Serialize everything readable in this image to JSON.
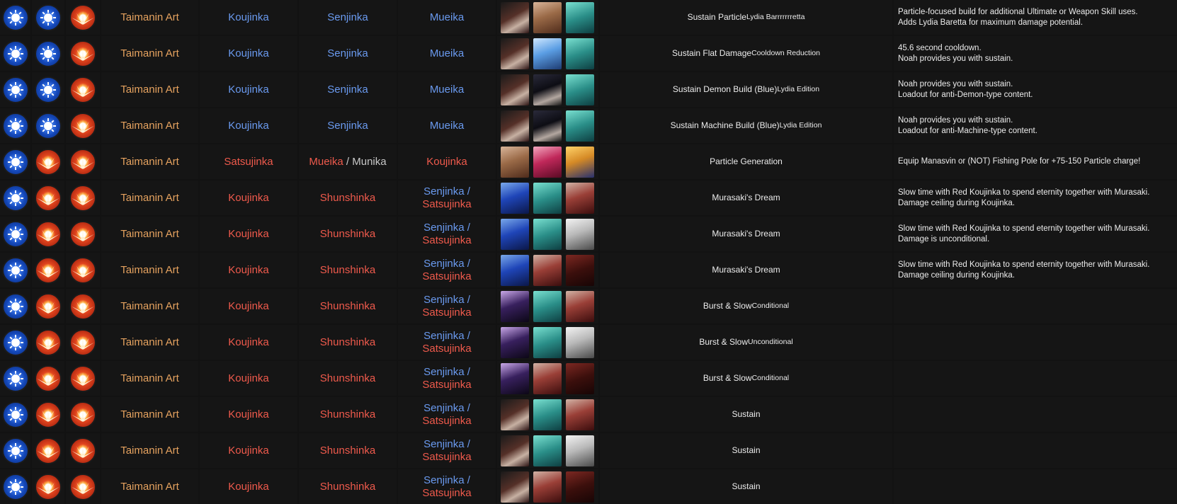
{
  "rows": [
    {
      "orbs": [
        "blue",
        "blue",
        "red"
      ],
      "specials": [
        {
          "parts": [
            {
              "text": "Taimanin Art",
              "color": "orange"
            }
          ]
        },
        {
          "parts": [
            {
              "text": "Koujinka",
              "color": "blue"
            }
          ]
        },
        {
          "parts": [
            {
              "text": "Senjinka",
              "color": "blue"
            }
          ]
        },
        {
          "parts": [
            {
              "text": "Mueika",
              "color": "blue"
            }
          ]
        }
      ],
      "portraits": [
        "dark-haired-fighter",
        "brown-haired-girl",
        "teal-haired-girl"
      ],
      "title": "Sustain Particle",
      "subtitle": "Lydia Barrrrrrretta",
      "notes": [
        "Particle-focused build for additional Ultimate or Weapon Skill uses.",
        "Adds Lydia Baretta for maximum damage potential."
      ]
    },
    {
      "orbs": [
        "blue",
        "blue",
        "red"
      ],
      "specials": [
        {
          "parts": [
            {
              "text": "Taimanin Art",
              "color": "orange"
            }
          ]
        },
        {
          "parts": [
            {
              "text": "Koujinka",
              "color": "blue"
            }
          ]
        },
        {
          "parts": [
            {
              "text": "Senjinka",
              "color": "blue"
            }
          ]
        },
        {
          "parts": [
            {
              "text": "Mueika",
              "color": "blue"
            }
          ]
        }
      ],
      "portraits": [
        "dark-haired-fighter",
        "light-blue-haired-girl",
        "teal-haired-girl"
      ],
      "title": "Sustain Flat Damage",
      "subtitle": "Cooldown Reduction",
      "notes": [
        "45.6 second cooldown.",
        "Noah provides you with sustain."
      ]
    },
    {
      "orbs": [
        "blue",
        "blue",
        "red"
      ],
      "specials": [
        {
          "parts": [
            {
              "text": "Taimanin Art",
              "color": "orange"
            }
          ]
        },
        {
          "parts": [
            {
              "text": "Koujinka",
              "color": "blue"
            }
          ]
        },
        {
          "parts": [
            {
              "text": "Senjinka",
              "color": "blue"
            }
          ]
        },
        {
          "parts": [
            {
              "text": "Mueika",
              "color": "blue"
            }
          ]
        }
      ],
      "portraits": [
        "dark-haired-fighter",
        "black-haired-girl",
        "teal-haired-girl"
      ],
      "title": "Sustain Demon Build (Blue)",
      "subtitle": "Lydia Edition",
      "notes": [
        "Noah provides you with sustain.",
        "Loadout for anti-Demon-type content."
      ]
    },
    {
      "orbs": [
        "blue",
        "blue",
        "red"
      ],
      "specials": [
        {
          "parts": [
            {
              "text": "Taimanin Art",
              "color": "orange"
            }
          ]
        },
        {
          "parts": [
            {
              "text": "Koujinka",
              "color": "blue"
            }
          ]
        },
        {
          "parts": [
            {
              "text": "Senjinka",
              "color": "blue"
            }
          ]
        },
        {
          "parts": [
            {
              "text": "Mueika",
              "color": "blue"
            }
          ]
        }
      ],
      "portraits": [
        "dark-haired-fighter",
        "black-haired-girl",
        "teal-haired-girl"
      ],
      "title": "Sustain Machine Build (Blue)",
      "subtitle": "Lydia Edition",
      "notes": [
        "Noah provides you with sustain.",
        "Loadout for anti-Machine-type content."
      ]
    },
    {
      "orbs": [
        "blue",
        "red",
        "red"
      ],
      "specials": [
        {
          "parts": [
            {
              "text": "Taimanin Art",
              "color": "orange"
            }
          ]
        },
        {
          "parts": [
            {
              "text": "Satsujinka",
              "color": "red"
            }
          ]
        },
        {
          "parts": [
            {
              "text": "Mueika",
              "color": "red"
            },
            {
              "text": " / ",
              "color": "gray"
            },
            {
              "text": "Munika",
              "color": "gray"
            }
          ]
        },
        {
          "parts": [
            {
              "text": "Koujinka",
              "color": "red"
            }
          ]
        }
      ],
      "portraits": [
        "brown-haired-girl",
        "pink-haired-girl",
        "blonde-haired-girl"
      ],
      "title": "Particle Generation",
      "subtitle": "",
      "notes": [
        "Equip Manasvin or (NOT) Fishing Pole for +75-150 Particle charge!"
      ]
    },
    {
      "orbs": [
        "blue",
        "red",
        "red"
      ],
      "specials": [
        {
          "parts": [
            {
              "text": "Taimanin Art",
              "color": "orange"
            }
          ]
        },
        {
          "parts": [
            {
              "text": "Koujinka",
              "color": "red"
            }
          ]
        },
        {
          "parts": [
            {
              "text": "Shunshinka",
              "color": "red"
            }
          ]
        },
        {
          "parts": [
            {
              "text": "Senjinka /",
              "color": "blue"
            },
            {
              "text": "Satsujinka",
              "color": "red",
              "br": true
            }
          ]
        }
      ],
      "portraits": [
        "blue-armored-girl",
        "teal-haired-girl",
        "hooded-girl"
      ],
      "title": "Murasaki's Dream",
      "subtitle": "",
      "notes": [
        "Slow time with Red Koujinka to spend eternity together with Murasaki.",
        "Damage ceiling during Koujinka."
      ]
    },
    {
      "orbs": [
        "blue",
        "red",
        "red"
      ],
      "specials": [
        {
          "parts": [
            {
              "text": "Taimanin Art",
              "color": "orange"
            }
          ]
        },
        {
          "parts": [
            {
              "text": "Koujinka",
              "color": "red"
            }
          ]
        },
        {
          "parts": [
            {
              "text": "Shunshinka",
              "color": "red"
            }
          ]
        },
        {
          "parts": [
            {
              "text": "Senjinka /",
              "color": "blue"
            },
            {
              "text": "Satsujinka",
              "color": "red",
              "br": true
            }
          ]
        }
      ],
      "portraits": [
        "blue-armored-girl",
        "teal-haired-girl",
        "white-haired-girl"
      ],
      "title": "Murasaki's Dream",
      "subtitle": "",
      "notes": [
        "Slow time with Red Koujinka to spend eternity together with Murasaki.",
        "Damage is unconditional."
      ]
    },
    {
      "orbs": [
        "blue",
        "red",
        "red"
      ],
      "specials": [
        {
          "parts": [
            {
              "text": "Taimanin Art",
              "color": "orange"
            }
          ]
        },
        {
          "parts": [
            {
              "text": "Koujinka",
              "color": "red"
            }
          ]
        },
        {
          "parts": [
            {
              "text": "Shunshinka",
              "color": "red"
            }
          ]
        },
        {
          "parts": [
            {
              "text": "Senjinka /",
              "color": "blue"
            },
            {
              "text": "Satsujinka",
              "color": "red",
              "br": true
            }
          ]
        }
      ],
      "portraits": [
        "blue-armored-girl",
        "hooded-girl",
        "crimson-haired-girl"
      ],
      "title": "Murasaki's Dream",
      "subtitle": "",
      "notes": [
        "Slow time with Red Koujinka to spend eternity together with Murasaki.",
        "Damage ceiling during Koujinka."
      ]
    },
    {
      "orbs": [
        "blue",
        "red",
        "red"
      ],
      "specials": [
        {
          "parts": [
            {
              "text": "Taimanin Art",
              "color": "orange"
            }
          ]
        },
        {
          "parts": [
            {
              "text": "Koujinka",
              "color": "red"
            }
          ]
        },
        {
          "parts": [
            {
              "text": "Shunshinka",
              "color": "red"
            }
          ]
        },
        {
          "parts": [
            {
              "text": "Senjinka /",
              "color": "blue"
            },
            {
              "text": "Satsujinka",
              "color": "red",
              "br": true
            }
          ]
        }
      ],
      "portraits": [
        "purple-haired-girl",
        "teal-haired-girl",
        "hooded-girl"
      ],
      "title": "Burst & Slow",
      "subtitle": "Conditional",
      "notes": []
    },
    {
      "orbs": [
        "blue",
        "red",
        "red"
      ],
      "specials": [
        {
          "parts": [
            {
              "text": "Taimanin Art",
              "color": "orange"
            }
          ]
        },
        {
          "parts": [
            {
              "text": "Koujinka",
              "color": "red"
            }
          ]
        },
        {
          "parts": [
            {
              "text": "Shunshinka",
              "color": "red"
            }
          ]
        },
        {
          "parts": [
            {
              "text": "Senjinka /",
              "color": "blue"
            },
            {
              "text": "Satsujinka",
              "color": "red",
              "br": true
            }
          ]
        }
      ],
      "portraits": [
        "purple-haired-girl",
        "teal-haired-girl",
        "white-haired-girl"
      ],
      "title": "Burst & Slow",
      "subtitle": "Unconditional",
      "notes": []
    },
    {
      "orbs": [
        "blue",
        "red",
        "red"
      ],
      "specials": [
        {
          "parts": [
            {
              "text": "Taimanin Art",
              "color": "orange"
            }
          ]
        },
        {
          "parts": [
            {
              "text": "Koujinka",
              "color": "red"
            }
          ]
        },
        {
          "parts": [
            {
              "text": "Shunshinka",
              "color": "red"
            }
          ]
        },
        {
          "parts": [
            {
              "text": "Senjinka /",
              "color": "blue"
            },
            {
              "text": "Satsujinka",
              "color": "red",
              "br": true
            }
          ]
        }
      ],
      "portraits": [
        "purple-haired-girl",
        "hooded-girl",
        "crimson-haired-girl"
      ],
      "title": "Burst & Slow",
      "subtitle": "Conditional",
      "notes": []
    },
    {
      "orbs": [
        "blue",
        "red",
        "red"
      ],
      "specials": [
        {
          "parts": [
            {
              "text": "Taimanin Art",
              "color": "orange"
            }
          ]
        },
        {
          "parts": [
            {
              "text": "Koujinka",
              "color": "red"
            }
          ]
        },
        {
          "parts": [
            {
              "text": "Shunshinka",
              "color": "red"
            }
          ]
        },
        {
          "parts": [
            {
              "text": "Senjinka /",
              "color": "blue"
            },
            {
              "text": "Satsujinka",
              "color": "red",
              "br": true
            }
          ]
        }
      ],
      "portraits": [
        "dark-haired-fighter",
        "teal-haired-girl",
        "hooded-girl"
      ],
      "title": "Sustain",
      "subtitle": "",
      "notes": []
    },
    {
      "orbs": [
        "blue",
        "red",
        "red"
      ],
      "specials": [
        {
          "parts": [
            {
              "text": "Taimanin Art",
              "color": "orange"
            }
          ]
        },
        {
          "parts": [
            {
              "text": "Koujinka",
              "color": "red"
            }
          ]
        },
        {
          "parts": [
            {
              "text": "Shunshinka",
              "color": "red"
            }
          ]
        },
        {
          "parts": [
            {
              "text": "Senjinka /",
              "color": "blue"
            },
            {
              "text": "Satsujinka",
              "color": "red",
              "br": true
            }
          ]
        }
      ],
      "portraits": [
        "dark-haired-fighter",
        "teal-haired-girl",
        "white-haired-girl"
      ],
      "title": "Sustain",
      "subtitle": "",
      "notes": []
    },
    {
      "orbs": [
        "blue",
        "red",
        "red"
      ],
      "specials": [
        {
          "parts": [
            {
              "text": "Taimanin Art",
              "color": "orange"
            }
          ]
        },
        {
          "parts": [
            {
              "text": "Koujinka",
              "color": "red"
            }
          ]
        },
        {
          "parts": [
            {
              "text": "Shunshinka",
              "color": "red"
            }
          ]
        },
        {
          "parts": [
            {
              "text": "Senjinka /",
              "color": "blue"
            },
            {
              "text": "Satsujinka",
              "color": "red",
              "br": true
            }
          ]
        }
      ],
      "portraits": [
        "dark-haired-fighter",
        "hooded-girl",
        "crimson-haired-girl"
      ],
      "title": "Sustain",
      "subtitle": "",
      "notes": []
    }
  ],
  "colors": {
    "background": "#121212",
    "cell": "#151515",
    "orange": "#e5a25f",
    "blue": "#6a9aef",
    "red": "#ef5a4c",
    "gray": "#c8c8c8"
  }
}
